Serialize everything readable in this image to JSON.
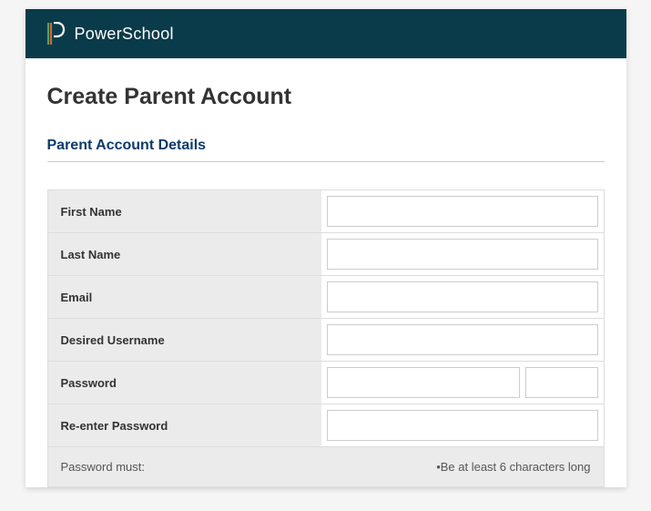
{
  "header": {
    "brand": "PowerSchool"
  },
  "page": {
    "title": "Create Parent Account",
    "section_title": "Parent Account Details"
  },
  "form": {
    "first_name_label": "First Name",
    "first_name_value": "",
    "last_name_label": "Last Name",
    "last_name_value": "",
    "email_label": "Email",
    "email_value": "",
    "username_label": "Desired Username",
    "username_value": "",
    "password_label": "Password",
    "password_value": "",
    "reenter_label": "Re-enter Password",
    "reenter_value": "",
    "hint_label": "Password must:",
    "hint_rule": "•Be at least 6 characters long"
  }
}
